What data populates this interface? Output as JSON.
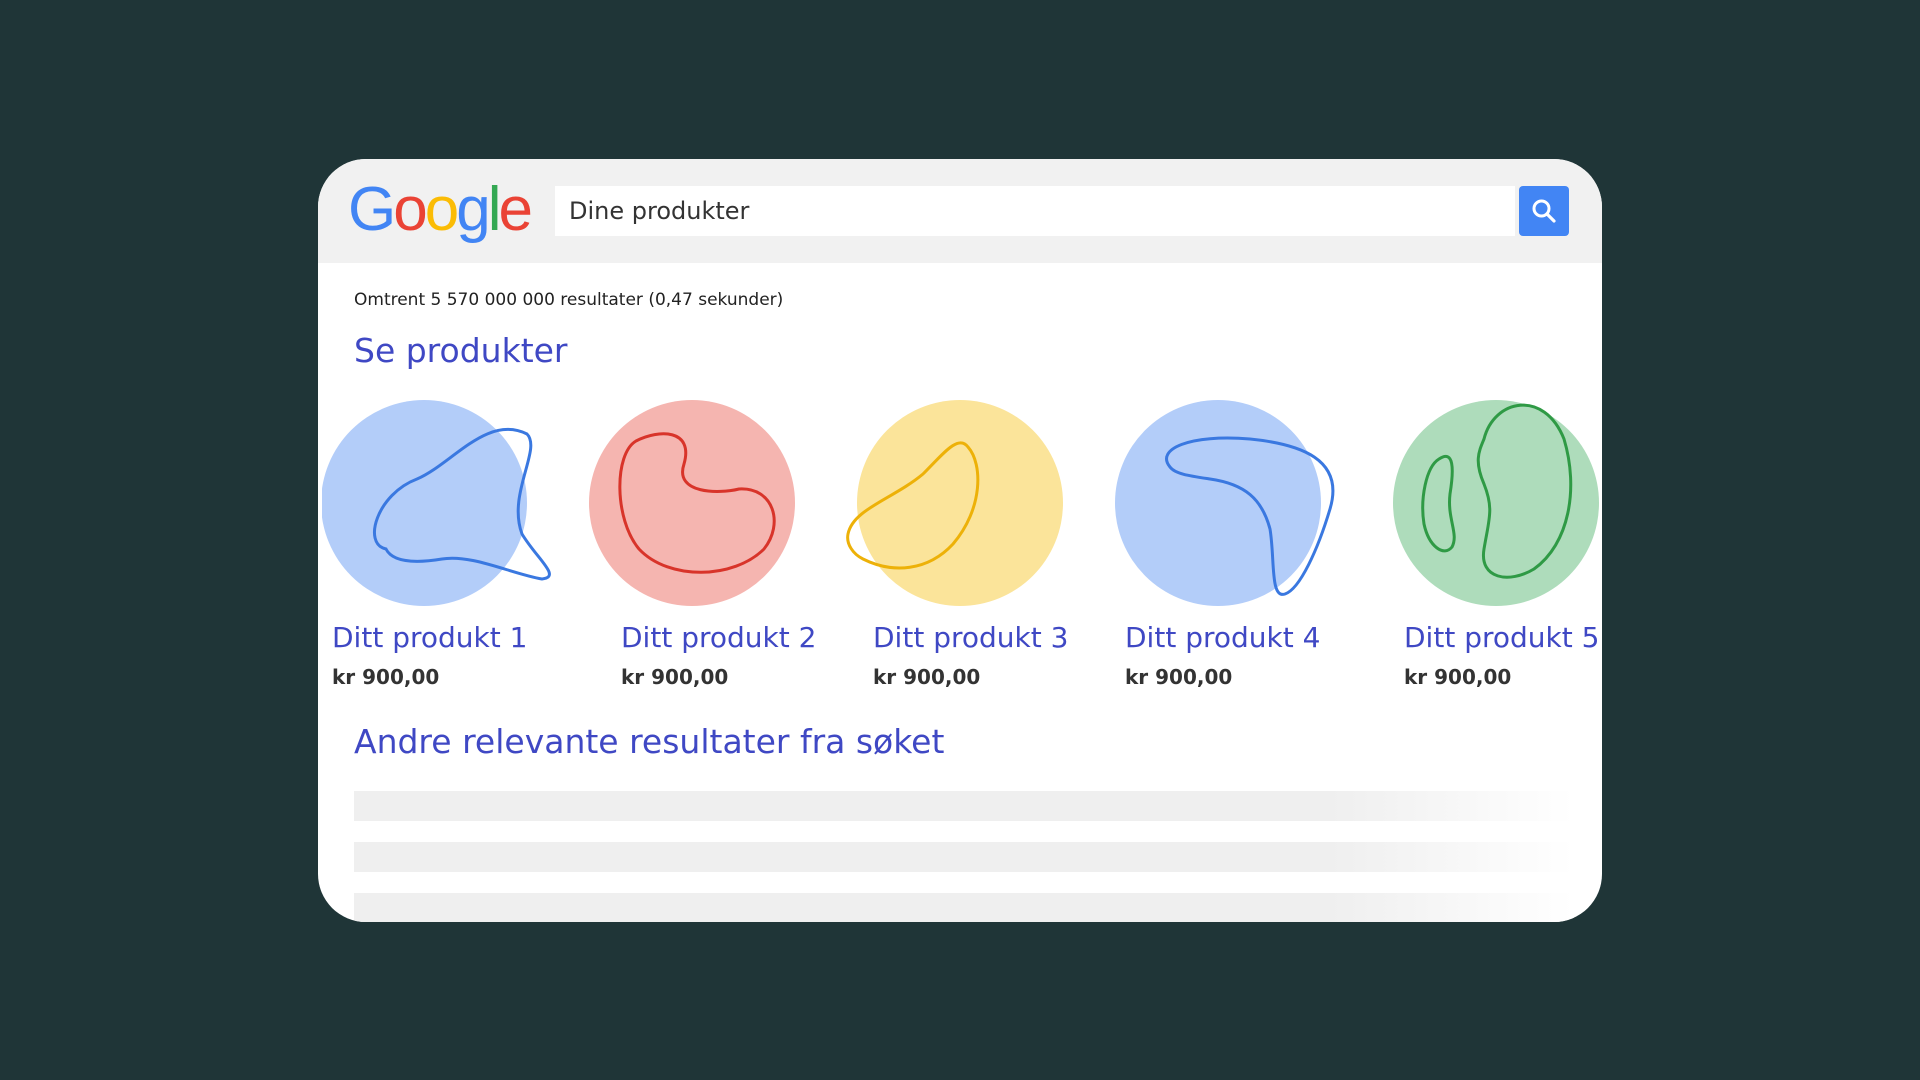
{
  "logo": {
    "letters": [
      "G",
      "o",
      "o",
      "g",
      "l",
      "e"
    ],
    "colors": [
      "#4285f4",
      "#ea4335",
      "#fbbc05",
      "#4285f4",
      "#34a853",
      "#ea4335"
    ]
  },
  "search": {
    "value": "Dine produkter",
    "button_icon": "search-icon"
  },
  "result_stats": "Omtrent 5 570 000 000 resultater (0,47 sekunder)",
  "sections": {
    "products_title": "Se produkter",
    "other_title": "Andre relevante resultater fra søket"
  },
  "products": [
    {
      "name": "Ditt produkt 1",
      "price": "kr 900,00",
      "fill": "#b3cdf9",
      "stroke": "#3a78e0"
    },
    {
      "name": "Ditt produkt 2",
      "price": "kr 900,00",
      "fill": "#f5b5b0",
      "stroke": "#d8342a"
    },
    {
      "name": "Ditt produkt 3",
      "price": "kr 900,00",
      "fill": "#fbe49a",
      "stroke": "#edb108"
    },
    {
      "name": "Ditt produkt 4",
      "price": "kr 900,00",
      "fill": "#b3cdf9",
      "stroke": "#3a78e0"
    },
    {
      "name": "Ditt produkt 5",
      "price": "kr 900,00",
      "fill": "#aedcbb",
      "stroke": "#2f9a45"
    }
  ],
  "colors": {
    "background": "#1f3537",
    "accent": "#3f48c4",
    "search_button": "#4285f4"
  }
}
